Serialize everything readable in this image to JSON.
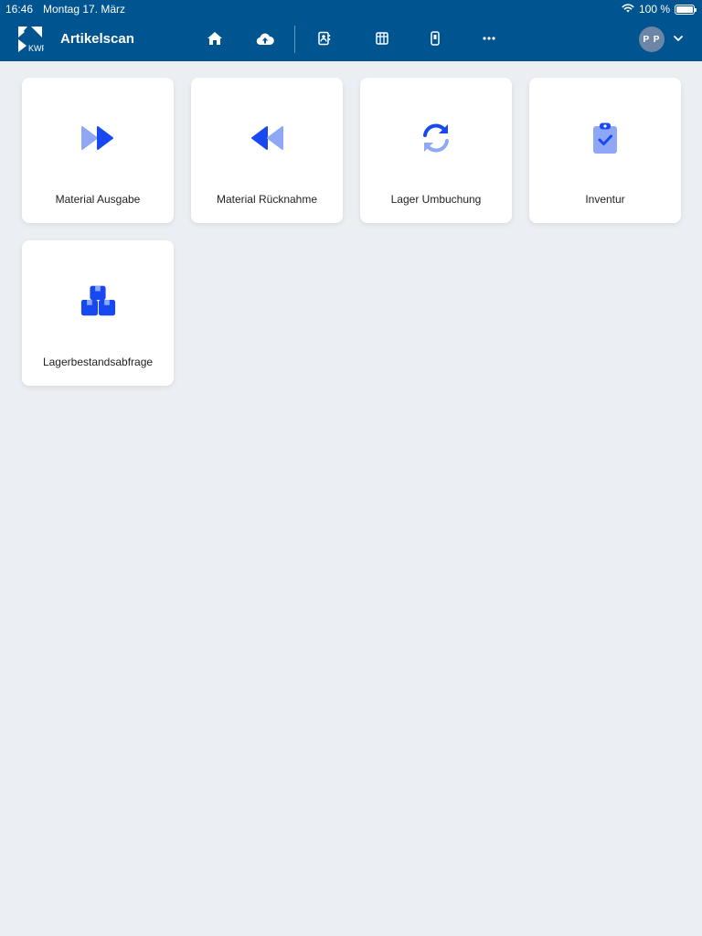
{
  "status_bar": {
    "time": "16:46",
    "date": "Montag 17. März",
    "battery": "100 %",
    "battery_level": 1.0
  },
  "header": {
    "title": "Artikelscan",
    "logo_icon": "kwp-logo",
    "nav_icons": [
      "home-icon",
      "cloud-upload-icon",
      "contacts-icon",
      "grid-icon",
      "device-icon",
      "more-icon"
    ],
    "avatar_initials": "P P"
  },
  "colors": {
    "header_bg": "#00548f",
    "background": "#ebeef2",
    "accent": "#1849f0",
    "accent_light": "#8ea8f7",
    "avatar_bg": "#6e86a6"
  },
  "tiles": [
    {
      "label": "Material Ausgabe",
      "icon": "fast-forward-icon"
    },
    {
      "label": "Material Rücknahme",
      "icon": "rewind-icon"
    },
    {
      "label": "Lager Umbuchung",
      "icon": "sync-icon"
    },
    {
      "label": "Inventur",
      "icon": "clipboard-check-icon"
    },
    {
      "label": "Lagerbestandsabfrage",
      "icon": "boxes-icon"
    }
  ]
}
